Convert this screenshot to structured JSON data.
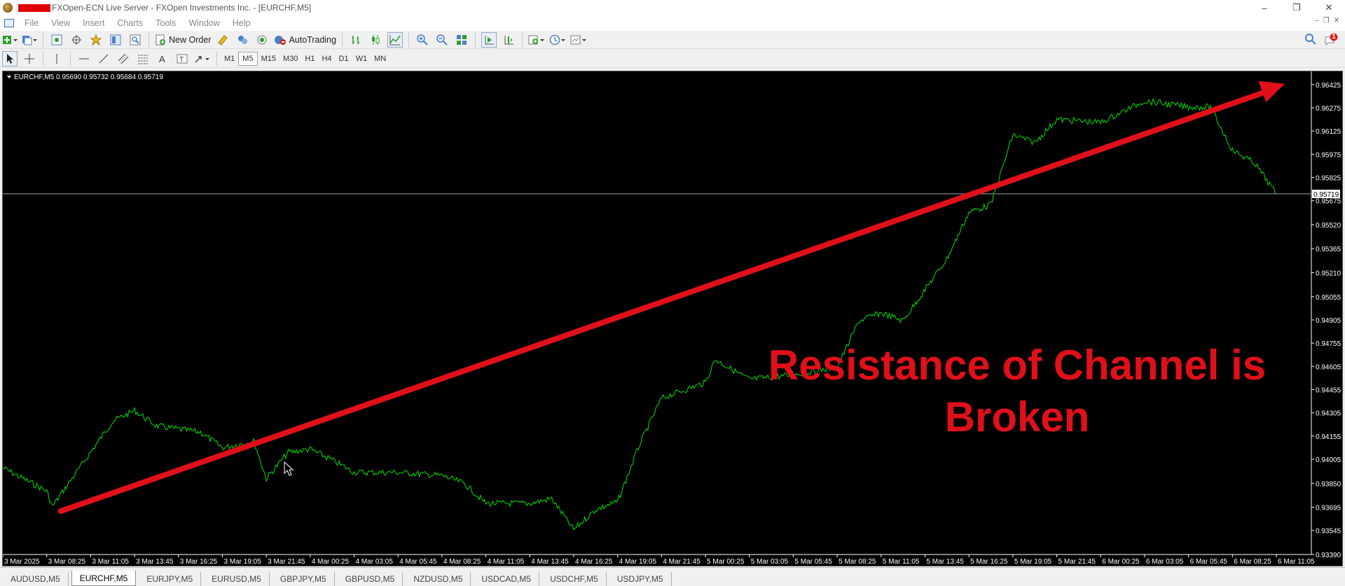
{
  "window": {
    "title": "FXOpen-ECN Live Server - FXOpen Investments Inc. - [EURCHF,M5]",
    "controls": [
      "–",
      "❐",
      "✕"
    ],
    "mdi_controls": [
      "–",
      "❐",
      "✕"
    ]
  },
  "menu": [
    "File",
    "View",
    "Insert",
    "Charts",
    "Tools",
    "Window",
    "Help"
  ],
  "toolbar": {
    "new_order_label": "New Order",
    "autotrading_label": "AutoTrading",
    "notification_count": "1"
  },
  "timeframes": [
    "M1",
    "M5",
    "M15",
    "M30",
    "H1",
    "H4",
    "D1",
    "W1",
    "MN"
  ],
  "active_timeframe": "M5",
  "chart": {
    "info": "EURCHF,M5  0.95690 0.95732 0.95684 0.95719",
    "current_price": "0.95719",
    "annotation_line1": "Resistance of Channel is",
    "annotation_line2": "Broken",
    "colors": {
      "background": "#000000",
      "price_line": "#00e000",
      "trend_arrow": "#e0101a",
      "annotation": "#e0101a",
      "axis_text": "#ffffff"
    }
  },
  "chart_data": {
    "type": "line",
    "symbol": "EURCHF",
    "timeframe": "M5",
    "y_ticks": [
      "0.96425",
      "0.96275",
      "0.96125",
      "0.95975",
      "0.95825",
      "0.95675",
      "0.95520",
      "0.95365",
      "0.95210",
      "0.95055",
      "0.94905",
      "0.94755",
      "0.94605",
      "0.94455",
      "0.94305",
      "0.94155",
      "0.94005",
      "0.93850",
      "0.93695",
      "0.93545",
      "0.93390"
    ],
    "x_ticks": [
      "3 Mar 2025",
      "3 Mar 08:25",
      "3 Mar 11:05",
      "3 Mar 13:45",
      "3 Mar 16:25",
      "3 Mar 19:05",
      "3 Mar 21:45",
      "4 Mar 00:25",
      "4 Mar 03:05",
      "4 Mar 05:45",
      "4 Mar 08:25",
      "4 Mar 11:05",
      "4 Mar 13:45",
      "4 Mar 16:25",
      "4 Mar 19:05",
      "4 Mar 21:45",
      "5 Mar 00:25",
      "5 Mar 03:05",
      "5 Mar 05:45",
      "5 Mar 08:25",
      "5 Mar 11:05",
      "5 Mar 13:45",
      "5 Mar 16:25",
      "5 Mar 19:05",
      "5 Mar 21:45",
      "6 Mar 00:25",
      "6 Mar 03:05",
      "6 Mar 05:45",
      "6 Mar 08:25",
      "6 Mar 11:05"
    ],
    "ylim": [
      0.9339,
      0.9651
    ],
    "series": [
      {
        "points": [
          [
            "3 Mar 2025",
            0.9395
          ],
          [
            "3 Mar 08:25",
            0.938
          ],
          [
            "3 Mar 08:45",
            0.937
          ],
          [
            "3 Mar 11:05",
            0.9405
          ],
          [
            "3 Mar 12:25",
            0.9425
          ],
          [
            "3 Mar 13:45",
            0.9432
          ],
          [
            "3 Mar 15:05",
            0.9422
          ],
          [
            "3 Mar 16:25",
            0.942
          ],
          [
            "3 Mar 17:45",
            0.9418
          ],
          [
            "3 Mar 19:05",
            0.9408
          ],
          [
            "3 Mar 21:00",
            0.9412
          ],
          [
            "3 Mar 21:45",
            0.9388
          ],
          [
            "3 Mar 23:05",
            0.9405
          ],
          [
            "4 Mar 00:25",
            0.9407
          ],
          [
            "4 Mar 01:45",
            0.94
          ],
          [
            "4 Mar 03:05",
            0.9392
          ],
          [
            "4 Mar 05:45",
            0.9392
          ],
          [
            "4 Mar 08:25",
            0.939
          ],
          [
            "4 Mar 09:45",
            0.9385
          ],
          [
            "4 Mar 11:05",
            0.9372
          ],
          [
            "4 Mar 13:45",
            0.9372
          ],
          [
            "4 Mar 15:05",
            0.9375
          ],
          [
            "4 Mar 16:25",
            0.9355
          ],
          [
            "4 Mar 17:45",
            0.9368
          ],
          [
            "4 Mar 19:05",
            0.9373
          ],
          [
            "4 Mar 20:25",
            0.941
          ],
          [
            "4 Mar 21:45",
            0.944
          ],
          [
            "5 Mar 00:25",
            0.945
          ],
          [
            "5 Mar 01:00",
            0.9465
          ],
          [
            "5 Mar 03:05",
            0.9452
          ],
          [
            "5 Mar 05:45",
            0.9455
          ],
          [
            "5 Mar 08:25",
            0.946
          ],
          [
            "5 Mar 09:45",
            0.949
          ],
          [
            "5 Mar 11:05",
            0.9495
          ],
          [
            "5 Mar 12:25",
            0.949
          ],
          [
            "5 Mar 13:45",
            0.951
          ],
          [
            "5 Mar 15:05",
            0.953
          ],
          [
            "5 Mar 16:25",
            0.956
          ],
          [
            "5 Mar 17:45",
            0.9565
          ],
          [
            "5 Mar 19:05",
            0.961
          ],
          [
            "5 Mar 20:25",
            0.9605
          ],
          [
            "5 Mar 21:45",
            0.962
          ],
          [
            "6 Mar 00:25",
            0.9618
          ],
          [
            "6 Mar 03:05",
            0.9632
          ],
          [
            "6 Mar 05:45",
            0.9628
          ],
          [
            "6 Mar 07:05",
            0.9628
          ],
          [
            "6 Mar 08:25",
            0.96
          ],
          [
            "6 Mar 09:45",
            0.9592
          ],
          [
            "6 Mar 11:05",
            0.95719
          ]
        ]
      }
    ],
    "annotations": [
      {
        "type": "arrow",
        "from": [
          "3 Mar 08:25",
          0.9367
        ],
        "to": [
          "6 Mar 11:05",
          0.9643
        ]
      },
      {
        "type": "horizontal_line",
        "y": 0.95719
      }
    ],
    "grid": false
  },
  "tabs": [
    "AUDUSD,M5",
    "EURCHF,M5",
    "EURJPY,M5",
    "EURUSD,M5",
    "GBPJPY,M5",
    "GBPUSD,M5",
    "NZDUSD,M5",
    "USDCAD,M5",
    "USDCHF,M5",
    "USDJPY,M5"
  ],
  "active_tab": "EURCHF,M5"
}
